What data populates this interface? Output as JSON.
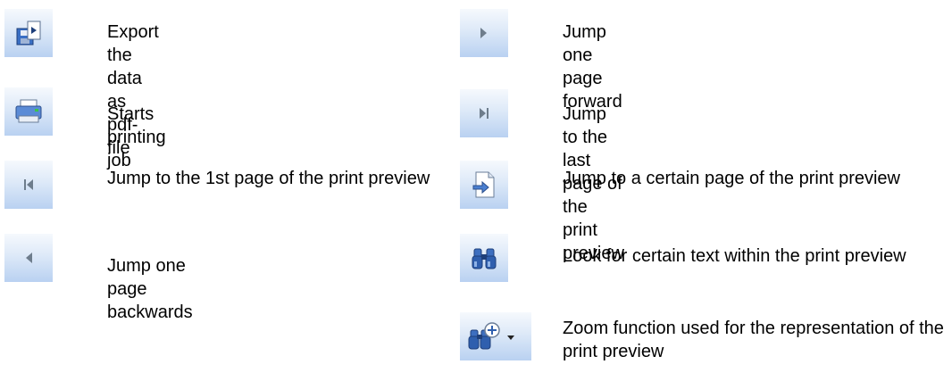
{
  "items": [
    {
      "icon": "export-pdf-icon",
      "label": "Export the data as pdf-file"
    },
    {
      "icon": "printer-icon",
      "label": "Starts printing job"
    },
    {
      "icon": "first-page-icon",
      "label": "Jump to the 1st page of the print preview"
    },
    {
      "icon": "previous-page-icon",
      "label": "Jump one page backwards"
    },
    {
      "icon": "next-page-icon",
      "label": "Jump one page forward"
    },
    {
      "icon": "last-page-icon",
      "label": "Jump to the last page of the print preview"
    },
    {
      "icon": "go-to-page-icon",
      "label": "Jump to a certain page of the print preview"
    },
    {
      "icon": "binoculars-icon",
      "label": "Look for certain text within the print preview"
    },
    {
      "icon": "zoom-icon",
      "label": "Zoom function used for the representation of the print preview"
    }
  ]
}
